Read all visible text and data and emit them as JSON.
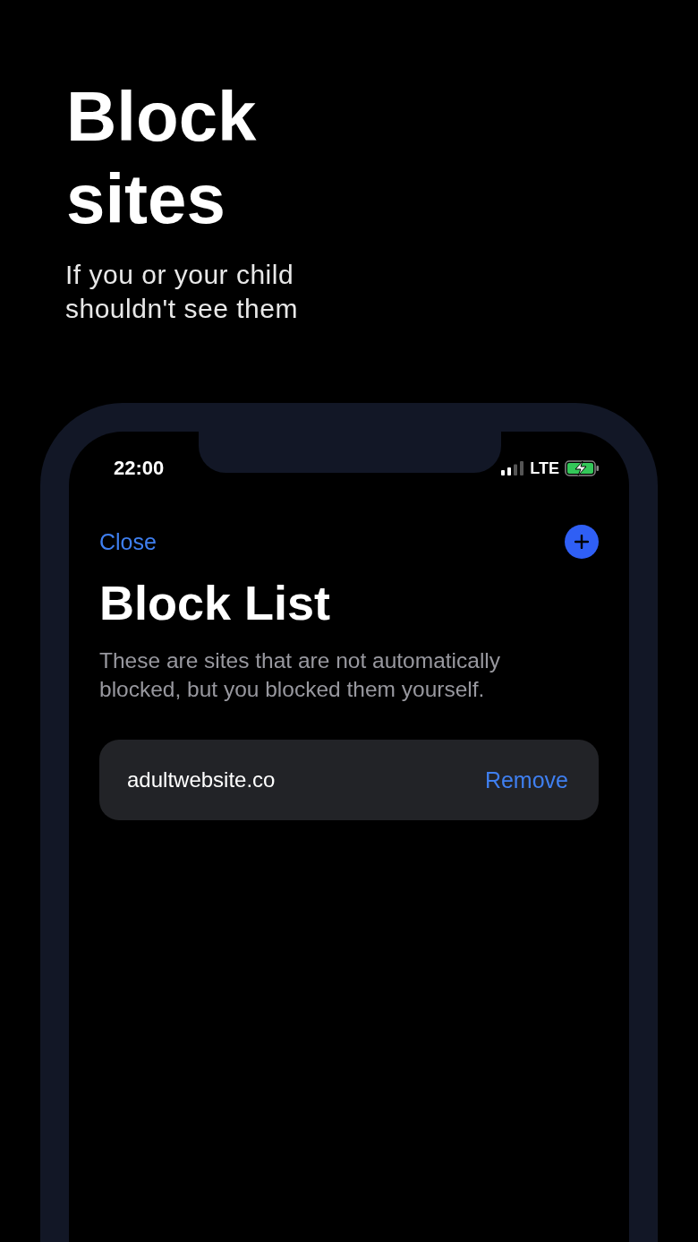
{
  "headline": {
    "title_lines": [
      "Block",
      "sites"
    ],
    "subtitle_lines": [
      "If you or your child",
      "shouldn't see them"
    ]
  },
  "status_bar": {
    "time": "22:00",
    "network": "LTE"
  },
  "nav": {
    "close": "Close"
  },
  "page": {
    "title": "Block List",
    "description": "These are sites that are not automatically blocked, but you blocked them yourself."
  },
  "sites": [
    {
      "domain": "adultwebsite.co",
      "action": "Remove"
    }
  ]
}
